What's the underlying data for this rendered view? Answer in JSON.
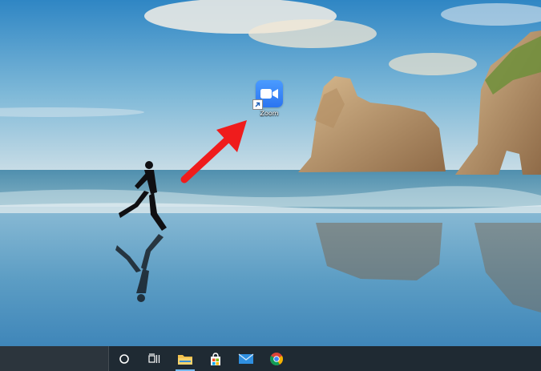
{
  "desktop": {
    "icons": [
      {
        "label": "Zoom",
        "icon": "zoom-app-icon"
      }
    ]
  },
  "taskbar": {
    "buttons": [
      {
        "icon": "cortana-icon"
      },
      {
        "icon": "task-view-icon"
      },
      {
        "icon": "file-explorer-icon"
      },
      {
        "icon": "microsoft-store-icon"
      },
      {
        "icon": "mail-icon"
      },
      {
        "icon": "chrome-icon"
      }
    ]
  },
  "colors": {
    "zoom_blue": "#2d8cff",
    "arrow_red": "#ef1c1c",
    "taskbar_bg": "#1f2a33"
  }
}
